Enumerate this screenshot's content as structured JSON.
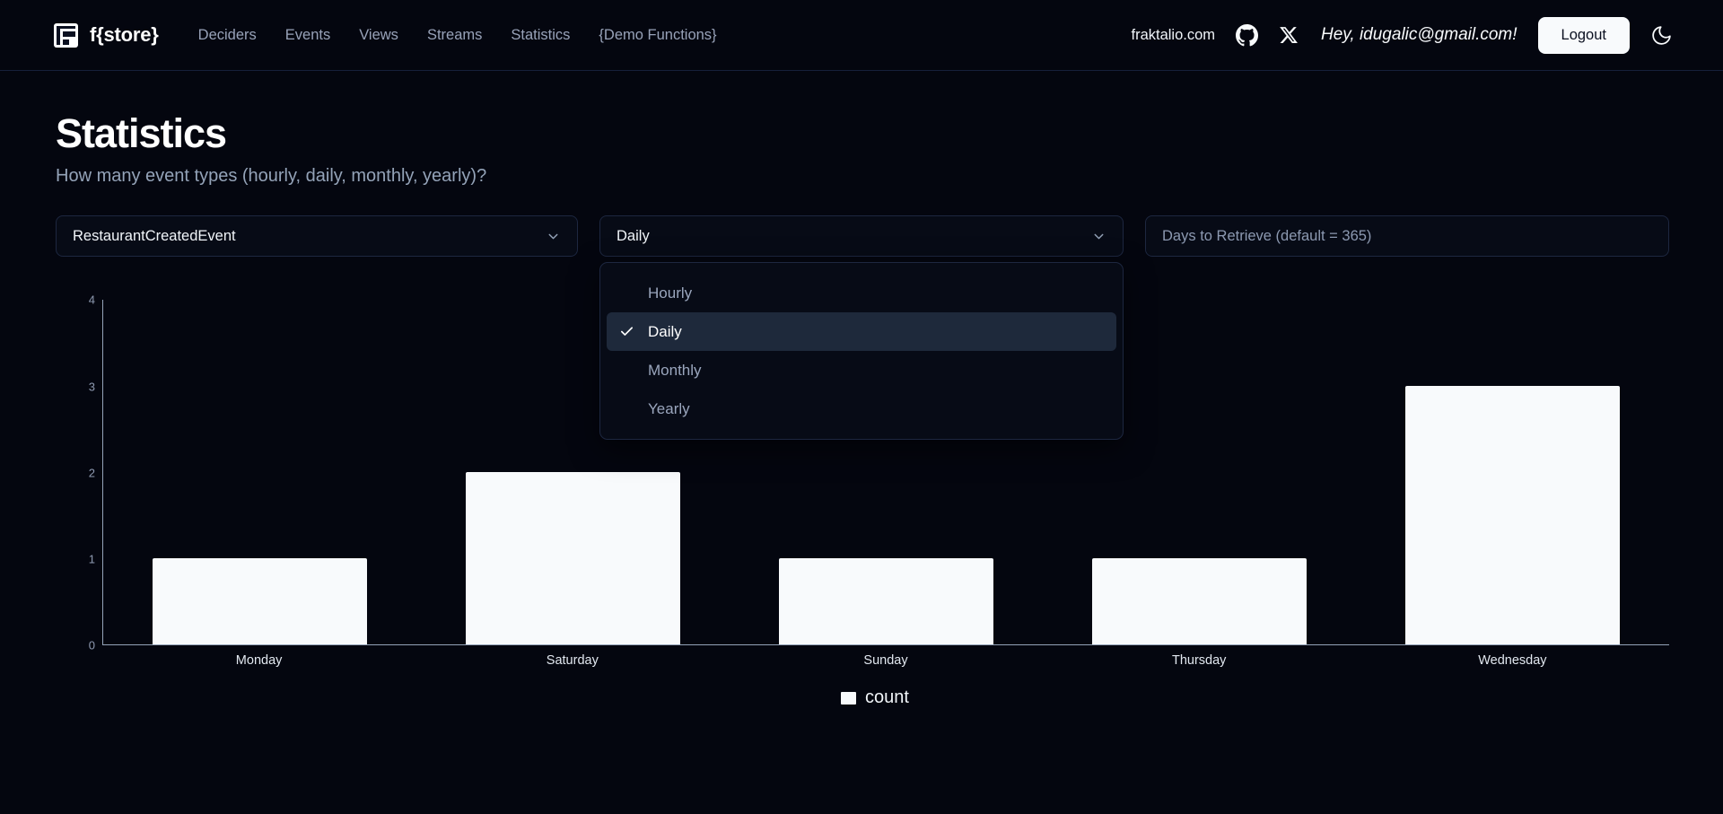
{
  "header": {
    "brand": "f{store}",
    "brand_icon": "store-logo-icon",
    "nav": [
      {
        "label": "Deciders"
      },
      {
        "label": "Events"
      },
      {
        "label": "Views"
      },
      {
        "label": "Streams"
      },
      {
        "label": "Statistics"
      },
      {
        "label": "{Demo Functions}"
      }
    ],
    "site_link": "fraktalio.com",
    "github_icon": "github-icon",
    "x_icon": "x-twitter-icon",
    "greeting": "Hey, idugalic@gmail.com!",
    "logout_label": "Logout",
    "theme_toggle_icon": "moon-icon"
  },
  "page": {
    "title": "Statistics",
    "subtitle": "How many event types (hourly, daily, monthly, yearly)?"
  },
  "controls": {
    "event_select": {
      "value": "RestaurantCreatedEvent",
      "chevron_icon": "chevron-down-icon"
    },
    "interval_select": {
      "value": "Daily",
      "chevron_icon": "chevron-down-icon",
      "open": true,
      "check_icon": "check-icon",
      "options": [
        {
          "label": "Hourly",
          "selected": false
        },
        {
          "label": "Daily",
          "selected": true
        },
        {
          "label": "Monthly",
          "selected": false
        },
        {
          "label": "Yearly",
          "selected": false
        }
      ]
    },
    "days_input": {
      "value": "",
      "placeholder": "Days to Retrieve (default = 365)"
    }
  },
  "colors": {
    "background": "#04060f",
    "panel": "#070b16",
    "border": "#1d2740",
    "accent": "#f8fafc",
    "muted_text": "#94a3b8",
    "menu_selected": "#1e293b"
  },
  "chart_data": {
    "type": "bar",
    "title": "",
    "xlabel": "",
    "ylabel": "",
    "categories": [
      "Monday",
      "Saturday",
      "Sunday",
      "Thursday",
      "Wednesday"
    ],
    "values": [
      1,
      2,
      1,
      1,
      3
    ],
    "series": [
      {
        "name": "count",
        "values": [
          1,
          2,
          1,
          1,
          3
        ]
      }
    ],
    "yticks": [
      0,
      1,
      2,
      3,
      4
    ],
    "ylim": [
      0,
      4
    ],
    "grid": false,
    "legend": [
      {
        "label": "count",
        "color": "#f8fafc"
      }
    ],
    "legend_position": "bottom",
    "bar_color": "#f8fafc"
  }
}
